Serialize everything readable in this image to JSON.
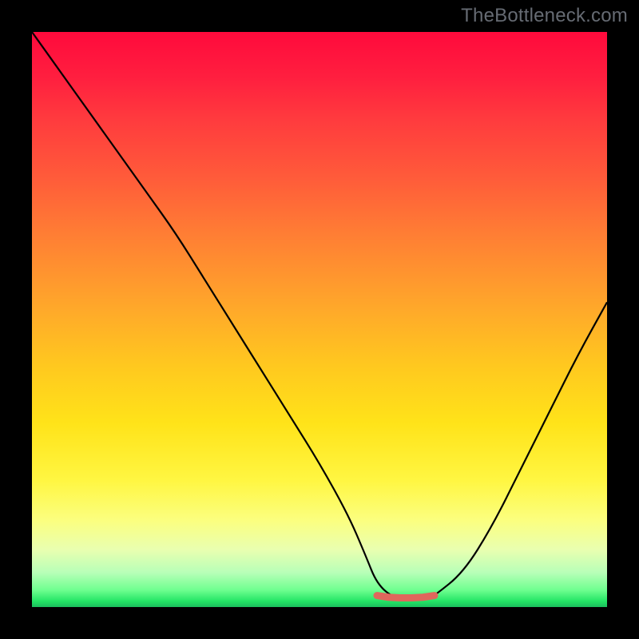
{
  "watermark": "TheBottleneck.com",
  "chart_data": {
    "type": "line",
    "title": "",
    "xlabel": "",
    "ylabel": "",
    "xlim": [
      0,
      100
    ],
    "ylim": [
      0,
      100
    ],
    "grid": false,
    "series": [
      {
        "name": "bottleneck-curve",
        "x": [
          0,
          5,
          10,
          15,
          20,
          25,
          30,
          35,
          40,
          45,
          50,
          55,
          58,
          60,
          63,
          66,
          69,
          70,
          75,
          80,
          85,
          90,
          95,
          100
        ],
        "y": [
          100,
          93,
          86,
          79,
          72,
          65,
          57,
          49,
          41,
          33,
          25,
          16,
          9,
          4,
          1.5,
          1.5,
          1.5,
          2,
          6,
          14,
          24,
          34,
          44,
          53
        ]
      },
      {
        "name": "optimal-band",
        "x": [
          60,
          62,
          64,
          66,
          68,
          70
        ],
        "y": [
          2.0,
          1.7,
          1.6,
          1.6,
          1.7,
          2.0
        ]
      }
    ],
    "colors": {
      "curve": "#000000",
      "band": "#e0675c"
    },
    "background_gradient_stops": [
      {
        "pos": 0.0,
        "hex": "#ff0a3c"
      },
      {
        "pos": 0.25,
        "hex": "#ff5a3a"
      },
      {
        "pos": 0.5,
        "hex": "#ffb424"
      },
      {
        "pos": 0.75,
        "hex": "#fff040"
      },
      {
        "pos": 0.92,
        "hex": "#d0ffb0"
      },
      {
        "pos": 1.0,
        "hex": "#1CBF5E"
      }
    ]
  }
}
